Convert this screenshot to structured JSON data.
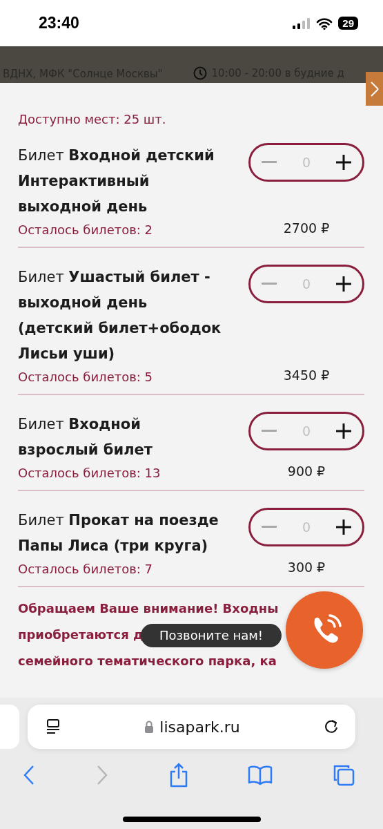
{
  "status_bar": {
    "time": "23:40",
    "battery": "29"
  },
  "header": {
    "address": "ВДНХ, МФК \"Солнце Москвы\"",
    "hours": "10:00 - 20:00 в будние д"
  },
  "available": "Доступно мест: 25 шт.",
  "tickets": [
    {
      "prefix": "Билет",
      "name": "Входной детский Интерактивный выходной день",
      "remaining": "Осталось билетов: 2",
      "quantity": "0",
      "decrement_disabled": true,
      "price": "2700 ₽"
    },
    {
      "prefix": "Билет",
      "name": "Ушастый билет - выходной день (детский билет+ободок Лисьи уши)",
      "remaining": "Осталось билетов: 5",
      "quantity": "0",
      "decrement_disabled": true,
      "price": "3450 ₽"
    },
    {
      "prefix": "Билет",
      "name": "Входной взрослый билет",
      "remaining": "Осталось билетов: 13",
      "quantity": "0",
      "decrement_disabled": true,
      "price": "900 ₽"
    },
    {
      "prefix": "Билет",
      "name": "Прокат на поезде Папы Лиса (три круга)",
      "remaining": "Осталось билетов: 7",
      "quantity": "0",
      "decrement_disabled": true,
      "price": "300 ₽"
    }
  ],
  "notice_lines": [
    "Обращаем Ваше внимание! Входны",
    "приобретаются д",
    "семейного тематического парка, ка"
  ],
  "toast": "Позвоните нам!",
  "browser": {
    "url": "lisapark.ru"
  }
}
